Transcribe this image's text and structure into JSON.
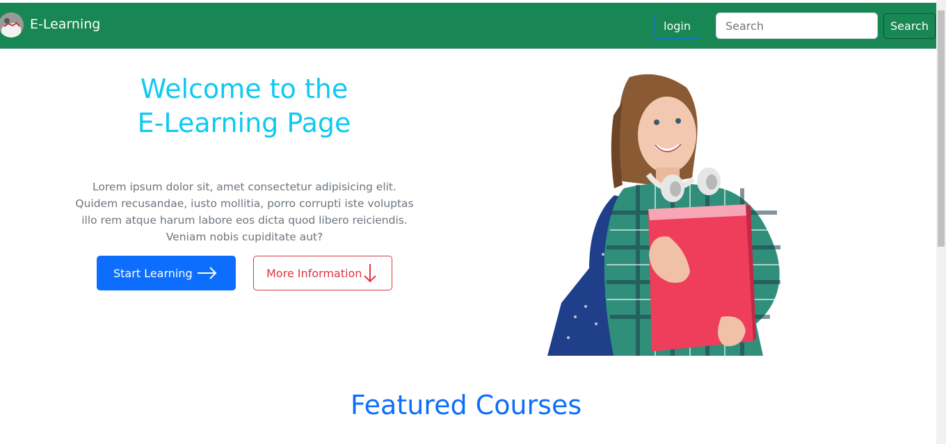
{
  "navbar": {
    "brand": "E-Learning",
    "login_label": "login",
    "search_placeholder": "Search",
    "search_button_label": "Search",
    "background_color": "#198754"
  },
  "hero": {
    "title_line1": "Welcome to the",
    "title_line2": "E-Learning Page",
    "description": "Lorem ipsum dolor sit, amet consectetur adipisicing elit. Quidem recusandae, iusto mollitia, porro corrupti iste voluptas illo rem atque harum labore eos dicta quod libero reiciendis. Veniam nobis cupiditate aut?",
    "primary_button": {
      "label": "Start Learning",
      "icon": "arrow-right-icon",
      "color": "#0d6efd"
    },
    "secondary_button": {
      "label": "More Information",
      "icon": "arrow-down-icon",
      "color": "#dc3545"
    },
    "title_color": "#0dcaf0"
  },
  "featured": {
    "title": "Featured Courses",
    "title_color": "#0d6efd"
  }
}
